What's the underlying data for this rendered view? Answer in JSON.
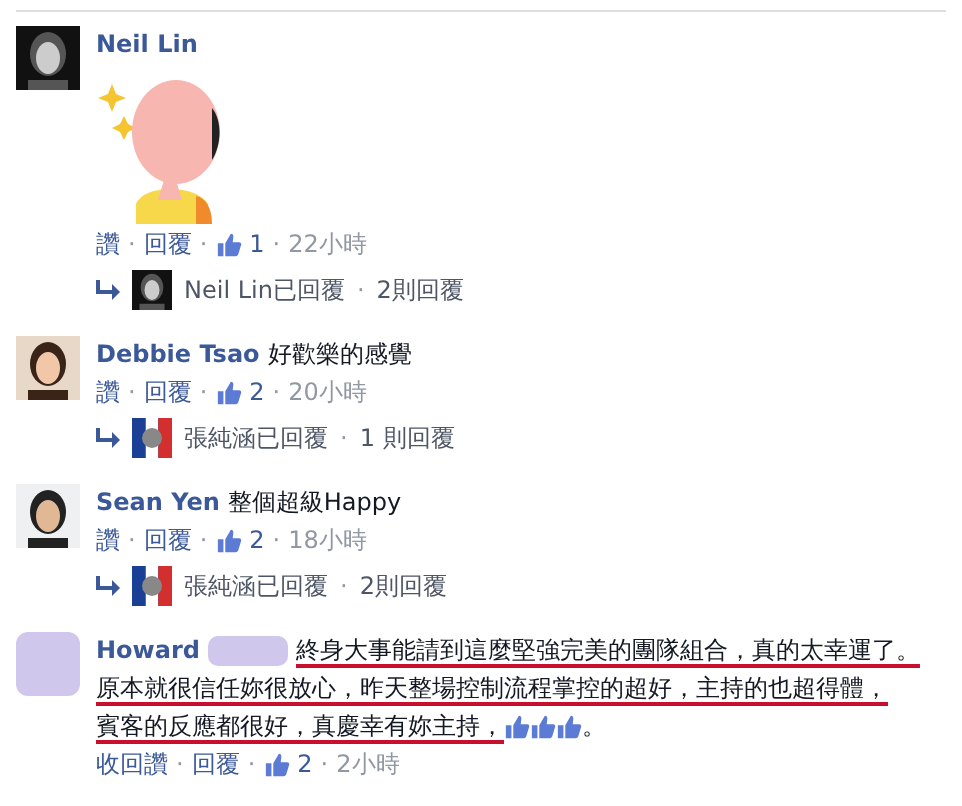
{
  "separator": "·",
  "comments": [
    {
      "avatar_redacted": false,
      "name": "Neil Lin",
      "name_redacted": false,
      "sticker": true,
      "actions": {
        "like": "讚",
        "reply": "回覆",
        "likes": "1",
        "time": "22小時"
      },
      "reply_summary": {
        "text": "Neil Lin已回覆",
        "count": "2則回覆"
      }
    },
    {
      "avatar_redacted": false,
      "name": "Debbie Tsao",
      "name_redacted": false,
      "text_lines": [
        "好歡樂的感覺"
      ],
      "actions": {
        "like": "讚",
        "reply": "回覆",
        "likes": "2",
        "time": "20小時"
      },
      "reply_summary": {
        "text": "張純涵已回覆",
        "count": "1 則回覆"
      }
    },
    {
      "avatar_redacted": false,
      "name": "Sean Yen",
      "name_redacted": false,
      "text_lines": [
        "整個超級Happy"
      ],
      "actions": {
        "like": "讚",
        "reply": "回覆",
        "likes": "2",
        "time": "18小時"
      },
      "reply_summary": {
        "text": "張純涵已回覆",
        "count": "2則回覆"
      }
    },
    {
      "avatar_redacted": true,
      "name": "Howard",
      "name_redacted": true,
      "underlined": true,
      "text_lines": [
        "終身大事能請到這麼堅強完美的團隊組合，真的太幸運了。",
        "原本就很信任妳很放心，昨天整場控制流程掌控的超好，主持的也超得體，",
        "賓客的反應都很好，真慶幸有妳主持，"
      ],
      "trailing_icons": [
        {
          "kind": "like"
        },
        {
          "kind": "like"
        },
        {
          "kind": "like"
        }
      ],
      "text_end": "。",
      "actions": {
        "like": "收回讚",
        "reply": "回覆",
        "likes": "2",
        "time": "2小時"
      }
    }
  ]
}
